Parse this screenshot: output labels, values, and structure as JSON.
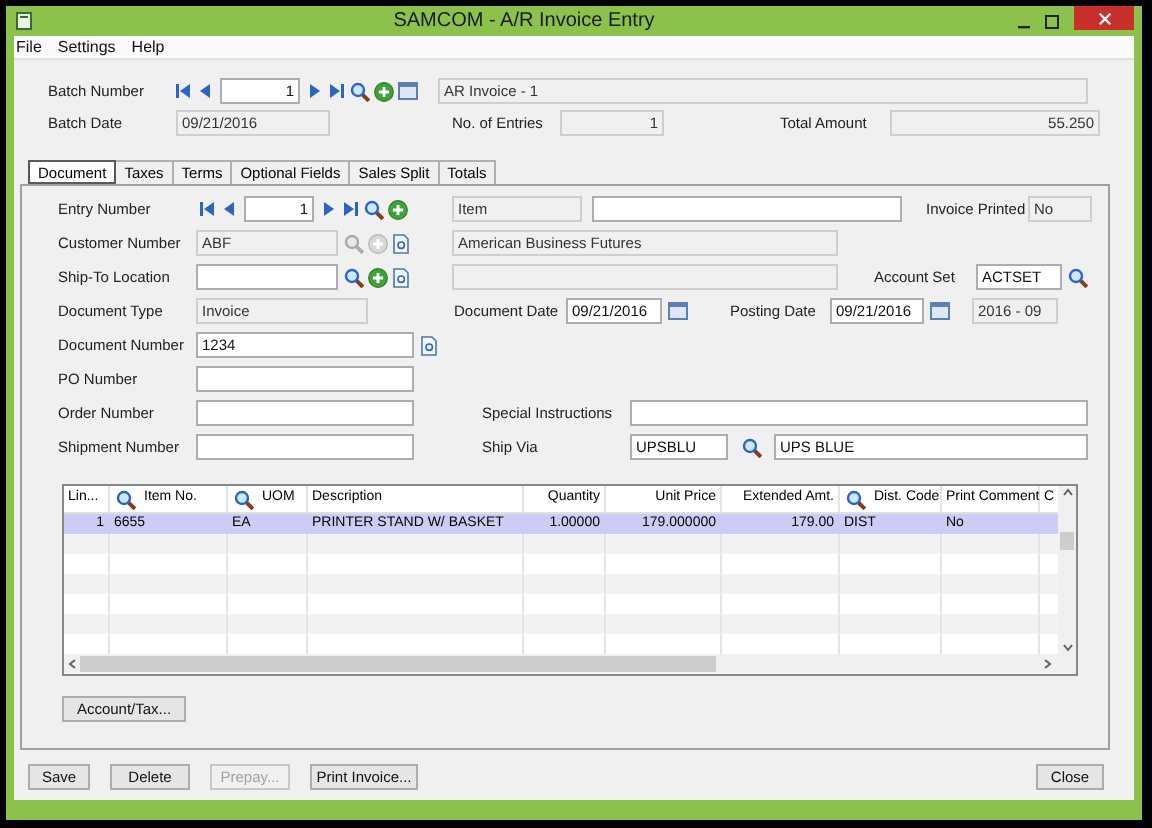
{
  "window": {
    "title": "SAMCOM - A/R Invoice Entry"
  },
  "menu": [
    {
      "label": "File"
    },
    {
      "label": "Settings"
    },
    {
      "label": "Help"
    }
  ],
  "batch": {
    "number": {
      "label": "Batch Number",
      "value": "1"
    },
    "description": "AR Invoice - 1",
    "date": {
      "label": "Batch Date",
      "value": "09/21/2016"
    },
    "entries": {
      "label": "No. of Entries",
      "value": "1"
    },
    "total": {
      "label": "Total Amount",
      "value": "55.250"
    }
  },
  "tabs": [
    {
      "label": "Document",
      "selected": true
    },
    {
      "label": "Taxes",
      "selected": false
    },
    {
      "label": "Terms",
      "selected": false
    },
    {
      "label": "Optional Fields",
      "selected": false
    },
    {
      "label": "Sales Split",
      "selected": false
    },
    {
      "label": "Totals",
      "selected": false
    }
  ],
  "document": {
    "entry_number": {
      "label": "Entry Number",
      "value": "1"
    },
    "item": "Item",
    "invoice_printed": {
      "label": "Invoice Printed",
      "value": "No"
    },
    "customer_number": {
      "label": "Customer Number",
      "value": "ABF",
      "readonly": true
    },
    "customer_name": "American Business Futures",
    "ship_to": {
      "label": "Ship-To Location",
      "readonly": false
    },
    "account_set": {
      "label": "Account Set",
      "value": "ACTSET"
    },
    "document_type": {
      "label": "Document Type",
      "value": "Invoice"
    },
    "document_date": {
      "label": "Document Date",
      "value": "09/21/2016"
    },
    "posting_date": {
      "label": "Posting Date",
      "value": "09/21/2016"
    },
    "fiscal_period": "2016 - 09",
    "document_number": {
      "label": "Document Number",
      "value": "1234"
    },
    "po_number": {
      "label": "PO Number"
    },
    "order_number": {
      "label": "Order Number"
    },
    "special_instructions": {
      "label": "Special Instructions"
    },
    "shipment_number": {
      "label": "Shipment Number"
    },
    "ship_via": {
      "label": "Ship Via",
      "code": "UPSBLU",
      "name": "UPS BLUE"
    }
  },
  "grid": {
    "columns": [
      {
        "label": "Lin...",
        "lookup": false,
        "kind": "number"
      },
      {
        "label": "Item No.",
        "lookup": true,
        "kind": "text"
      },
      {
        "label": "UOM",
        "lookup": true,
        "kind": "text"
      },
      {
        "label": "Description",
        "lookup": false,
        "kind": "text"
      },
      {
        "label": "Quantity",
        "lookup": false,
        "kind": "number"
      },
      {
        "label": "Unit Price",
        "lookup": false,
        "kind": "number"
      },
      {
        "label": "Extended Amt.",
        "lookup": false,
        "kind": "number"
      },
      {
        "label": "Dist. Code",
        "lookup": true,
        "kind": "text"
      },
      {
        "label": "Print Comment",
        "lookup": false,
        "kind": "text"
      },
      {
        "label": "C",
        "lookup": false,
        "kind": "text"
      }
    ],
    "rows": [
      {
        "selected": true,
        "cells": [
          "1",
          "6655",
          "EA",
          "PRINTER STAND W/ BASKET",
          "1.00000",
          "179.000000",
          "179.00",
          "DIST",
          "No",
          ""
        ]
      }
    ]
  },
  "account_tax_button": "Account/Tax...",
  "buttons": [
    {
      "label": "Save",
      "disabled": false
    },
    {
      "label": "Delete",
      "disabled": false
    },
    {
      "label": "Prepay...",
      "disabled": true
    },
    {
      "label": "Print Invoice...",
      "disabled": false
    }
  ],
  "close_button": "Close"
}
